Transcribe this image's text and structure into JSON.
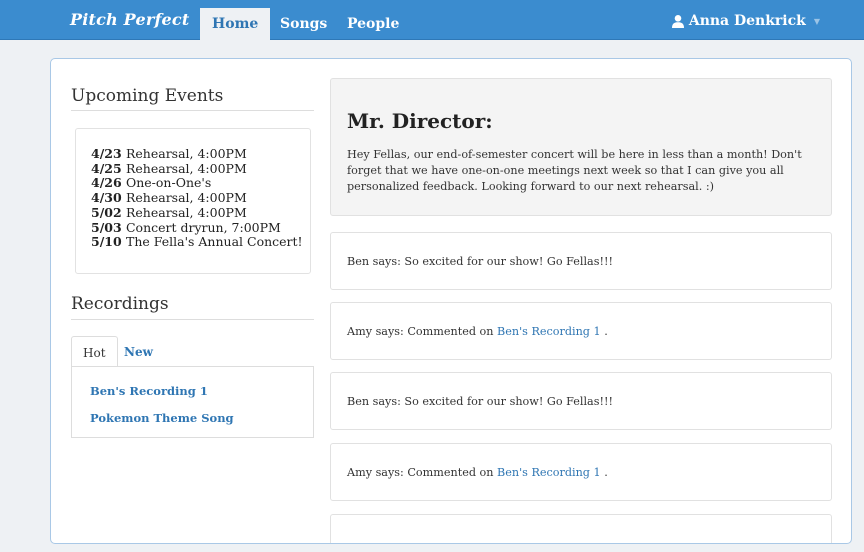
{
  "nav": {
    "brand": "Pitch Perfect",
    "tabs": [
      "Home",
      "Songs",
      "People"
    ],
    "user_name": "Anna Denkrick"
  },
  "upcoming": {
    "title": "Upcoming Events",
    "events": [
      {
        "date": "4/23",
        "label": "Rehearsal, 4:00PM"
      },
      {
        "date": "4/25",
        "label": "Rehearsal, 4:00PM"
      },
      {
        "date": "4/26",
        "label": "One-on-One's"
      },
      {
        "date": "4/30",
        "label": "Rehearsal, 4:00PM"
      },
      {
        "date": "5/02",
        "label": "Rehearsal, 4:00PM"
      },
      {
        "date": "5/03",
        "label": "Concert dryrun, 7:00PM"
      },
      {
        "date": "5/10",
        "label": "The Fella's Annual Concert!"
      }
    ]
  },
  "recordings": {
    "title": "Recordings",
    "tabs": [
      "Hot",
      "New"
    ],
    "items": [
      "Ben's Recording 1",
      "Pokemon Theme Song"
    ]
  },
  "director": {
    "title": "Mr. Director:",
    "message": "Hey Fellas, our end-of-semester concert will be here in less than a month! Don't forget that we have one-on-one meetings next week so that I can give you all personalized feedback. Looking forward to our next rehearsal. :)"
  },
  "feed": [
    {
      "text": "Ben says: So excited for our show! Go Fellas!!!",
      "link": "",
      "suffix": ""
    },
    {
      "text": "Amy says: Commented on ",
      "link": "Ben's Recording 1",
      "suffix": " ."
    },
    {
      "text": "Ben says: So excited for our show! Go Fellas!!!",
      "link": "",
      "suffix": ""
    },
    {
      "text": "Amy says: Commented on ",
      "link": "Ben's Recording 1",
      "suffix": " ."
    }
  ],
  "colors": {
    "navbar": "#3b8ccf",
    "link": "#2f76b3",
    "page_bg": "#eef1f4"
  }
}
